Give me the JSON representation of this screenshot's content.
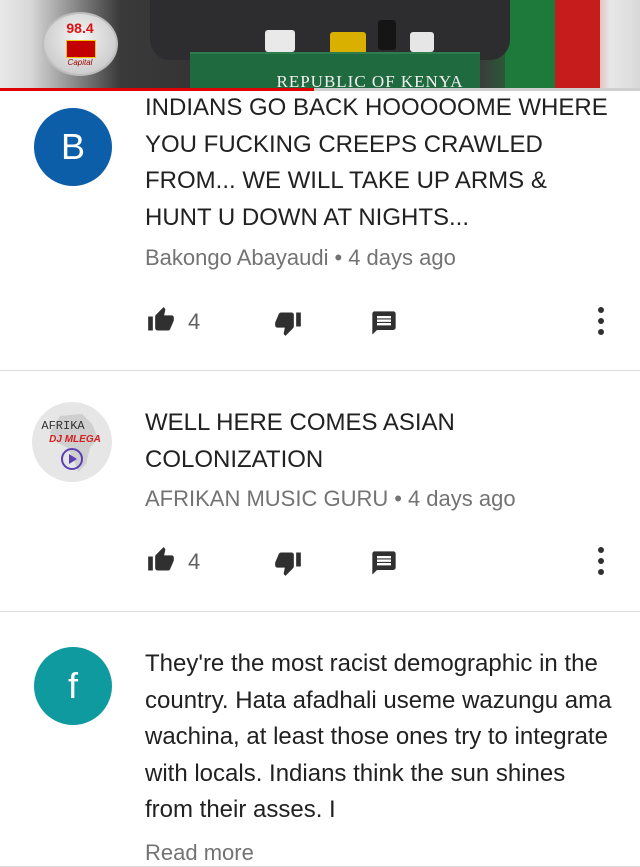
{
  "video": {
    "podium_text": "REPUBLIC OF KENYA",
    "channel_logo_number": "98.4",
    "channel_logo_name": "Capital",
    "progress_fraction": 0.49,
    "colors": {
      "progress": "#e00000"
    }
  },
  "comments": [
    {
      "avatar_letter": "B",
      "avatar_color": "#0d5ea8",
      "text": "INDIANS GO BACK HOOOOOME WHERE YOU FUCKING CREEPS CRAWLED FROM... WE WILL TAKE UP ARMS & HUNT U DOWN AT NIGHTS...",
      "author": "Bakongo Abayaudi",
      "separator": "•",
      "time": "4 days ago",
      "likes": "4",
      "icons": [
        "thumb-up-icon",
        "thumb-down-icon",
        "reply-icon",
        "more-vert-icon"
      ]
    },
    {
      "avatar_letter": "",
      "avatar_text_top": "AFRIKA",
      "avatar_text_bottom": "DJ MLEGA",
      "text": "WELL HERE COMES ASIAN COLONIZATION",
      "author": "AFRIKAN MUSIC GURU",
      "separator": "•",
      "time": "4 days ago",
      "likes": "4",
      "icons": [
        "thumb-up-icon",
        "thumb-down-icon",
        "reply-icon",
        "more-vert-icon"
      ]
    },
    {
      "avatar_letter": "f",
      "avatar_color": "#0f9aa0",
      "text": "They're the most racist demographic in the country. Hata afadhali useme wazungu ama wachina, at least those ones try to integrate with locals. Indians think the sun shines from their asses. I",
      "read_more": "Read more"
    }
  ]
}
